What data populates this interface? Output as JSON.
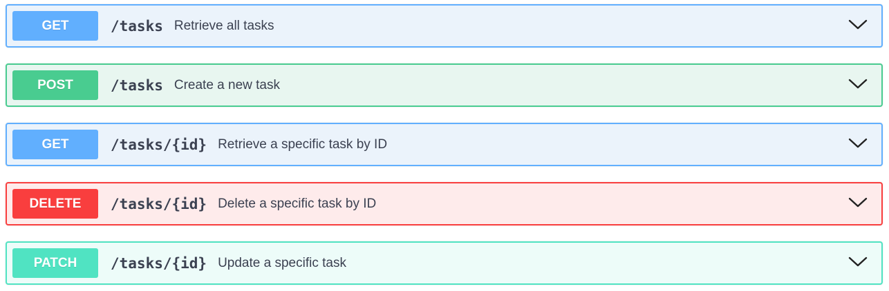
{
  "operations": [
    {
      "method": "GET",
      "path": "/tasks",
      "summary": "Retrieve all tasks",
      "colors": {
        "badge": "#61affe",
        "background": "#ebf3fb",
        "border": "#61affe"
      }
    },
    {
      "method": "POST",
      "path": "/tasks",
      "summary": "Create a new task",
      "colors": {
        "badge": "#49cc90",
        "background": "#e8f6f0",
        "border": "#49cc90"
      }
    },
    {
      "method": "GET",
      "path": "/tasks/{id}",
      "summary": "Retrieve a specific task by ID",
      "colors": {
        "badge": "#61affe",
        "background": "#ebf3fb",
        "border": "#61affe"
      }
    },
    {
      "method": "DELETE",
      "path": "/tasks/{id}",
      "summary": "Delete a specific task by ID",
      "colors": {
        "badge": "#f93e3e",
        "background": "#feebeb",
        "border": "#f93e3e"
      }
    },
    {
      "method": "PATCH",
      "path": "/tasks/{id}",
      "summary": "Update a specific task",
      "colors": {
        "badge": "#50e3c2",
        "background": "#edfcf9",
        "border": "#50e3c2"
      }
    }
  ],
  "icons": {
    "expand": "chevron-down-icon"
  }
}
